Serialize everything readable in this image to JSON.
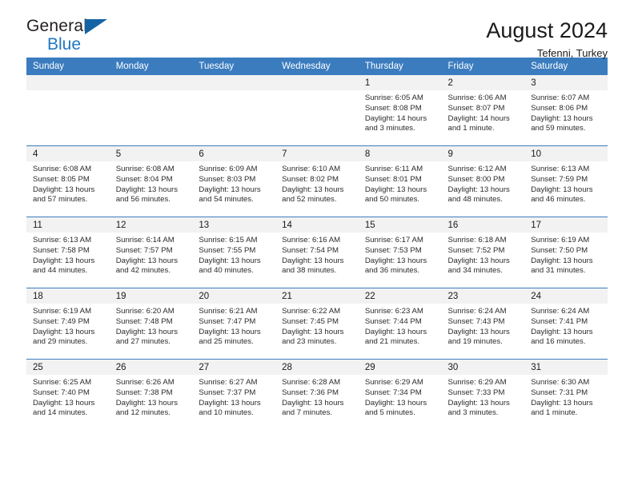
{
  "brand": {
    "name_top": "General",
    "name_bottom": "Blue",
    "triangle_color": "#1464a5",
    "blue_text_color": "#1f78c1"
  },
  "header": {
    "title": "August 2024",
    "subtitle": "Tefenni, Turkey",
    "header_bg": "#3b7cbf",
    "daynum_bg": "#f2f2f2"
  },
  "weekdays": [
    "Sunday",
    "Monday",
    "Tuesday",
    "Wednesday",
    "Thursday",
    "Friday",
    "Saturday"
  ],
  "weeks": [
    [
      {
        "day": "",
        "sunrise": "",
        "sunset": "",
        "daylight": "",
        "empty": true
      },
      {
        "day": "",
        "sunrise": "",
        "sunset": "",
        "daylight": "",
        "empty": true
      },
      {
        "day": "",
        "sunrise": "",
        "sunset": "",
        "daylight": "",
        "empty": true
      },
      {
        "day": "",
        "sunrise": "",
        "sunset": "",
        "daylight": "",
        "empty": true
      },
      {
        "day": "1",
        "sunrise": "Sunrise: 6:05 AM",
        "sunset": "Sunset: 8:08 PM",
        "daylight": "Daylight: 14 hours and 3 minutes."
      },
      {
        "day": "2",
        "sunrise": "Sunrise: 6:06 AM",
        "sunset": "Sunset: 8:07 PM",
        "daylight": "Daylight: 14 hours and 1 minute."
      },
      {
        "day": "3",
        "sunrise": "Sunrise: 6:07 AM",
        "sunset": "Sunset: 8:06 PM",
        "daylight": "Daylight: 13 hours and 59 minutes."
      }
    ],
    [
      {
        "day": "4",
        "sunrise": "Sunrise: 6:08 AM",
        "sunset": "Sunset: 8:05 PM",
        "daylight": "Daylight: 13 hours and 57 minutes."
      },
      {
        "day": "5",
        "sunrise": "Sunrise: 6:08 AM",
        "sunset": "Sunset: 8:04 PM",
        "daylight": "Daylight: 13 hours and 56 minutes."
      },
      {
        "day": "6",
        "sunrise": "Sunrise: 6:09 AM",
        "sunset": "Sunset: 8:03 PM",
        "daylight": "Daylight: 13 hours and 54 minutes."
      },
      {
        "day": "7",
        "sunrise": "Sunrise: 6:10 AM",
        "sunset": "Sunset: 8:02 PM",
        "daylight": "Daylight: 13 hours and 52 minutes."
      },
      {
        "day": "8",
        "sunrise": "Sunrise: 6:11 AM",
        "sunset": "Sunset: 8:01 PM",
        "daylight": "Daylight: 13 hours and 50 minutes."
      },
      {
        "day": "9",
        "sunrise": "Sunrise: 6:12 AM",
        "sunset": "Sunset: 8:00 PM",
        "daylight": "Daylight: 13 hours and 48 minutes."
      },
      {
        "day": "10",
        "sunrise": "Sunrise: 6:13 AM",
        "sunset": "Sunset: 7:59 PM",
        "daylight": "Daylight: 13 hours and 46 minutes."
      }
    ],
    [
      {
        "day": "11",
        "sunrise": "Sunrise: 6:13 AM",
        "sunset": "Sunset: 7:58 PM",
        "daylight": "Daylight: 13 hours and 44 minutes."
      },
      {
        "day": "12",
        "sunrise": "Sunrise: 6:14 AM",
        "sunset": "Sunset: 7:57 PM",
        "daylight": "Daylight: 13 hours and 42 minutes."
      },
      {
        "day": "13",
        "sunrise": "Sunrise: 6:15 AM",
        "sunset": "Sunset: 7:55 PM",
        "daylight": "Daylight: 13 hours and 40 minutes."
      },
      {
        "day": "14",
        "sunrise": "Sunrise: 6:16 AM",
        "sunset": "Sunset: 7:54 PM",
        "daylight": "Daylight: 13 hours and 38 minutes."
      },
      {
        "day": "15",
        "sunrise": "Sunrise: 6:17 AM",
        "sunset": "Sunset: 7:53 PM",
        "daylight": "Daylight: 13 hours and 36 minutes."
      },
      {
        "day": "16",
        "sunrise": "Sunrise: 6:18 AM",
        "sunset": "Sunset: 7:52 PM",
        "daylight": "Daylight: 13 hours and 34 minutes."
      },
      {
        "day": "17",
        "sunrise": "Sunrise: 6:19 AM",
        "sunset": "Sunset: 7:50 PM",
        "daylight": "Daylight: 13 hours and 31 minutes."
      }
    ],
    [
      {
        "day": "18",
        "sunrise": "Sunrise: 6:19 AM",
        "sunset": "Sunset: 7:49 PM",
        "daylight": "Daylight: 13 hours and 29 minutes."
      },
      {
        "day": "19",
        "sunrise": "Sunrise: 6:20 AM",
        "sunset": "Sunset: 7:48 PM",
        "daylight": "Daylight: 13 hours and 27 minutes."
      },
      {
        "day": "20",
        "sunrise": "Sunrise: 6:21 AM",
        "sunset": "Sunset: 7:47 PM",
        "daylight": "Daylight: 13 hours and 25 minutes."
      },
      {
        "day": "21",
        "sunrise": "Sunrise: 6:22 AM",
        "sunset": "Sunset: 7:45 PM",
        "daylight": "Daylight: 13 hours and 23 minutes."
      },
      {
        "day": "22",
        "sunrise": "Sunrise: 6:23 AM",
        "sunset": "Sunset: 7:44 PM",
        "daylight": "Daylight: 13 hours and 21 minutes."
      },
      {
        "day": "23",
        "sunrise": "Sunrise: 6:24 AM",
        "sunset": "Sunset: 7:43 PM",
        "daylight": "Daylight: 13 hours and 19 minutes."
      },
      {
        "day": "24",
        "sunrise": "Sunrise: 6:24 AM",
        "sunset": "Sunset: 7:41 PM",
        "daylight": "Daylight: 13 hours and 16 minutes."
      }
    ],
    [
      {
        "day": "25",
        "sunrise": "Sunrise: 6:25 AM",
        "sunset": "Sunset: 7:40 PM",
        "daylight": "Daylight: 13 hours and 14 minutes."
      },
      {
        "day": "26",
        "sunrise": "Sunrise: 6:26 AM",
        "sunset": "Sunset: 7:38 PM",
        "daylight": "Daylight: 13 hours and 12 minutes."
      },
      {
        "day": "27",
        "sunrise": "Sunrise: 6:27 AM",
        "sunset": "Sunset: 7:37 PM",
        "daylight": "Daylight: 13 hours and 10 minutes."
      },
      {
        "day": "28",
        "sunrise": "Sunrise: 6:28 AM",
        "sunset": "Sunset: 7:36 PM",
        "daylight": "Daylight: 13 hours and 7 minutes."
      },
      {
        "day": "29",
        "sunrise": "Sunrise: 6:29 AM",
        "sunset": "Sunset: 7:34 PM",
        "daylight": "Daylight: 13 hours and 5 minutes."
      },
      {
        "day": "30",
        "sunrise": "Sunrise: 6:29 AM",
        "sunset": "Sunset: 7:33 PM",
        "daylight": "Daylight: 13 hours and 3 minutes."
      },
      {
        "day": "31",
        "sunrise": "Sunrise: 6:30 AM",
        "sunset": "Sunset: 7:31 PM",
        "daylight": "Daylight: 13 hours and 1 minute."
      }
    ]
  ]
}
